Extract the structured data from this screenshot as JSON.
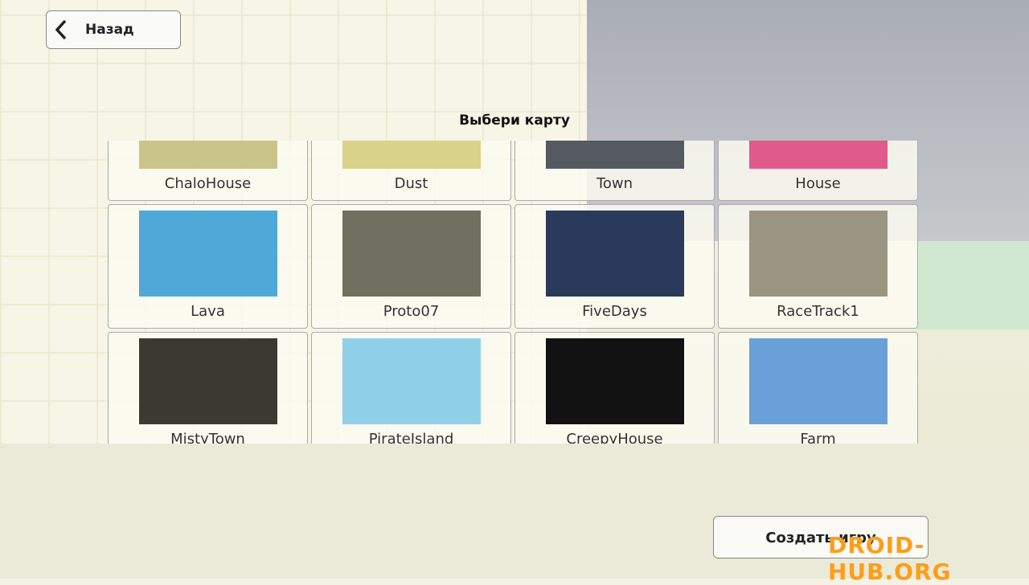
{
  "header": {
    "back_label": "Назад",
    "title": "Выбери карту"
  },
  "maps": [
    {
      "name": "ChaloHouse",
      "color": "#c9c58a"
    },
    {
      "name": "Dust",
      "color": "#d8d28a"
    },
    {
      "name": "Town",
      "color": "#555a60"
    },
    {
      "name": "House",
      "color": "#e05a8a"
    },
    {
      "name": "Lava",
      "color": "#4fa8d8"
    },
    {
      "name": "Proto07",
      "color": "#6f7060"
    },
    {
      "name": "FiveDays",
      "color": "#2a3a5a"
    },
    {
      "name": "RaceTrack1",
      "color": "#9a9580"
    },
    {
      "name": "MistyTown",
      "color": "#3a3a30"
    },
    {
      "name": "PirateIsland",
      "color": "#8fd0e8"
    },
    {
      "name": "CreepyHouse",
      "color": "#121212"
    },
    {
      "name": "Farm",
      "color": "#6aa0d8"
    }
  ],
  "footer": {
    "create_label": "Создать игру"
  },
  "watermark": "DROID-HUB.ORG"
}
